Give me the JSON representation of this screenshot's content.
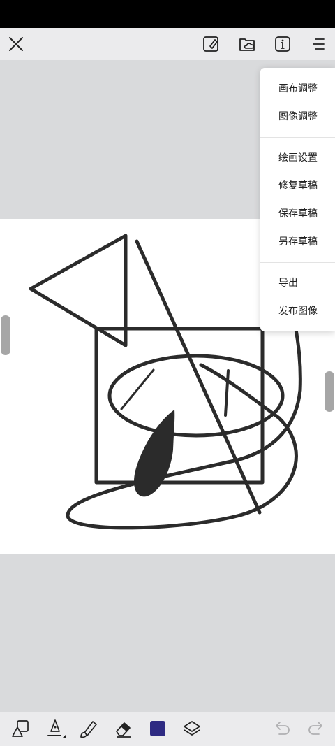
{
  "menu": {
    "items": [
      {
        "label": "画布调整"
      },
      {
        "label": "图像调整"
      },
      {
        "label": "绘画设置"
      },
      {
        "label": "修复草稿"
      },
      {
        "label": "保存草稿"
      },
      {
        "label": "另存草稿"
      },
      {
        "label": "导出"
      },
      {
        "label": "发布图像"
      }
    ]
  },
  "toolbar_top": {
    "icons": [
      "close-icon",
      "edit-canvas-icon",
      "cloud-folder-icon",
      "info-icon",
      "more-menu-icon"
    ]
  },
  "toolbar_bottom": {
    "icons": [
      "shapes-icon",
      "pen-icon",
      "brush-icon",
      "eraser-icon",
      "color-swatch",
      "layers-icon",
      "undo-icon",
      "redo-icon"
    ],
    "current_color": "#2e2a82"
  },
  "colors": {
    "toolbar_bg": "#ebebed",
    "workspace_bg": "#d9dadc",
    "canvas_bg": "#ffffff",
    "stroke": "#2b2b2b"
  }
}
